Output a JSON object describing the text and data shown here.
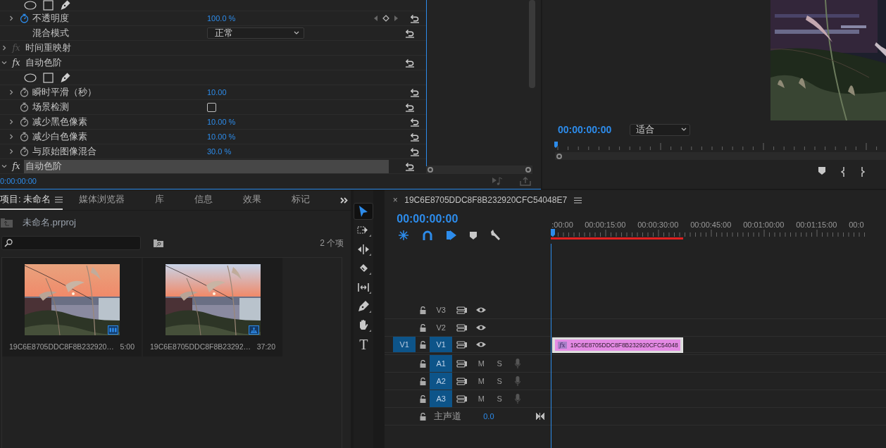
{
  "effect_controls": {
    "rows": [
      {
        "kind": "shapes"
      },
      {
        "kind": "param",
        "label": "不透明度",
        "value": "100.0 %",
        "expandable": true,
        "animated": true,
        "keyframe_nav": true
      },
      {
        "kind": "dropdown",
        "label": "混合模式",
        "value": "正常"
      },
      {
        "kind": "effect",
        "badge": "fx",
        "label": "时间重映射",
        "expanded": false,
        "enabled": false,
        "reset": false,
        "selected": false
      },
      {
        "kind": "effect",
        "badge": "fx",
        "label": "自动色阶",
        "expanded": true,
        "enabled": true,
        "reset": true,
        "selected": false
      },
      {
        "kind": "shapes"
      },
      {
        "kind": "param",
        "label": "瞬时平滑（秒）",
        "value": "10.00",
        "expandable": true,
        "animated": false,
        "keyframe_nav": false
      },
      {
        "kind": "checkbox",
        "label": "场景检测",
        "checked": false
      },
      {
        "kind": "param",
        "label": "减少黑色像素",
        "value": "10.00 %",
        "expandable": true,
        "animated": false,
        "keyframe_nav": false
      },
      {
        "kind": "param",
        "label": "减少白色像素",
        "value": "10.00 %",
        "expandable": true,
        "animated": false,
        "keyframe_nav": false
      },
      {
        "kind": "param",
        "label": "与原始图像混合",
        "value": "30.0 %",
        "expandable": true,
        "animated": false,
        "keyframe_nav": false
      },
      {
        "kind": "effect",
        "badge": "fx",
        "label": "自动色阶",
        "expanded": true,
        "enabled": true,
        "reset": true,
        "selected": true
      }
    ],
    "timecode": "0:00:00:00"
  },
  "program_monitor": {
    "timecode": "00:00:00:00",
    "zoom": "适合"
  },
  "project": {
    "tabs": [
      {
        "label": "项目: 未命名",
        "selected": true
      },
      {
        "label": "媒体浏览器",
        "selected": false
      },
      {
        "label": "库",
        "selected": false
      },
      {
        "label": "信息",
        "selected": false
      },
      {
        "label": "效果",
        "selected": false
      },
      {
        "label": "标记",
        "selected": false
      }
    ],
    "path": "未命名.prproj",
    "count": "2 个项",
    "items": [
      {
        "name": "19C6E8705DDC8F8B232920…",
        "duration": "5:00",
        "kind": "clip"
      },
      {
        "name": "19C6E8705DDC8F8B23292…",
        "duration": "37:20",
        "kind": "sequence"
      }
    ]
  },
  "tools": [
    {
      "kind": "selection",
      "selected": true
    },
    {
      "kind": "track_select",
      "selected": false
    },
    {
      "kind": "ripple",
      "selected": false
    },
    {
      "kind": "razor",
      "selected": false
    },
    {
      "kind": "slip",
      "selected": false
    },
    {
      "kind": "pen",
      "selected": false
    },
    {
      "kind": "hand",
      "selected": false
    },
    {
      "kind": "type",
      "selected": false,
      "glyph": "T"
    }
  ],
  "timeline": {
    "close": "×",
    "title": "19C6E8705DDC8F8B232920CFC54048E7",
    "timecode": "00:00:00:00",
    "ruler_labels": [
      ":00:00",
      "00:00:15:00",
      "00:00:30:00",
      "00:00:45:00",
      "00:01:00:00",
      "00:01:15:00",
      "00:0"
    ],
    "tracks": [
      {
        "kind": "video",
        "name": "V3",
        "targeted": false
      },
      {
        "kind": "video",
        "name": "V2",
        "targeted": false
      },
      {
        "kind": "video",
        "name": "V1",
        "targeted": true,
        "source": "V1",
        "clips": [
          {
            "name": "19C6E8705DDC8F8B232920CFC54048",
            "badge": "fx"
          }
        ]
      },
      {
        "kind": "audio",
        "name": "A1",
        "targeted": true,
        "mute": "M",
        "solo": "S"
      },
      {
        "kind": "audio",
        "name": "A2",
        "targeted": true,
        "mute": "M",
        "solo": "S"
      },
      {
        "kind": "audio",
        "name": "A3",
        "targeted": true,
        "mute": "M",
        "solo": "S"
      },
      {
        "kind": "master",
        "name": "主声道",
        "value": "0.0"
      }
    ]
  }
}
